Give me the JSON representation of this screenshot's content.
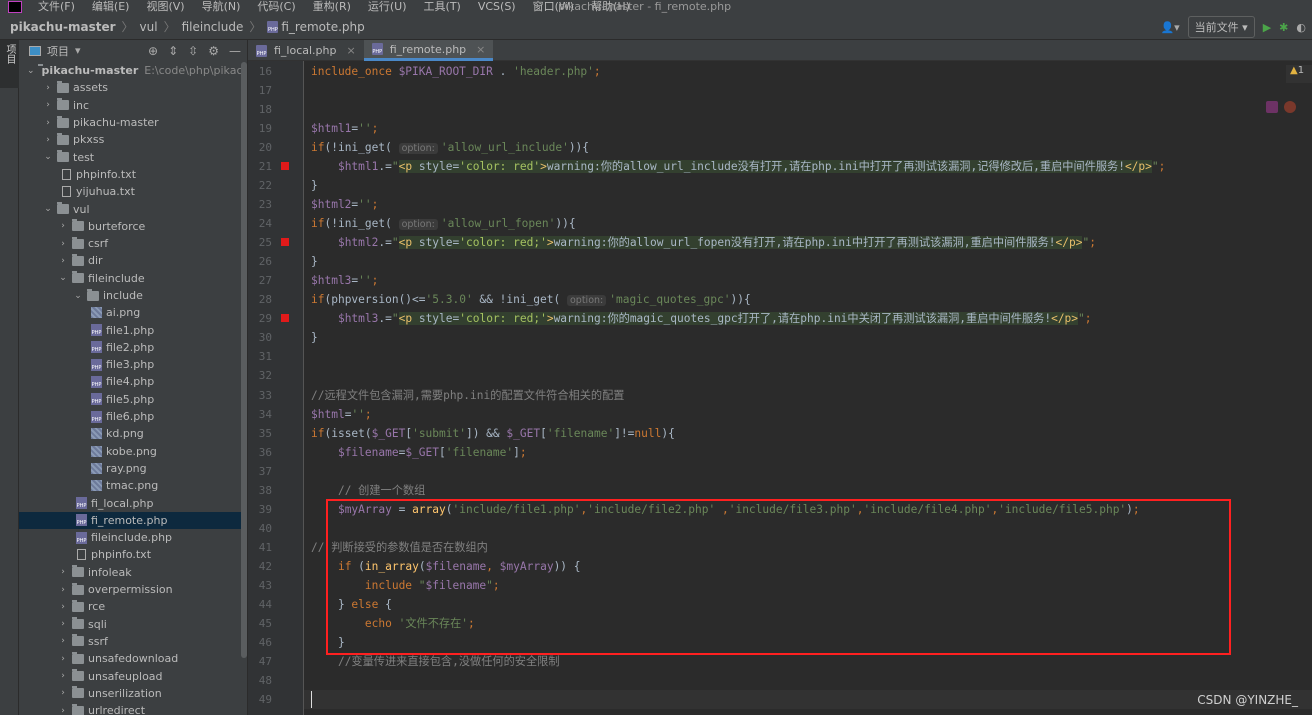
{
  "menubar": {
    "items": [
      "文件(F)",
      "编辑(E)",
      "视图(V)",
      "导航(N)",
      "代码(C)",
      "重构(R)",
      "运行(U)",
      "工具(T)",
      "VCS(S)",
      "窗口(W)",
      "帮助(H)"
    ],
    "title": "pikachu-master - fi_remote.php"
  },
  "breadcrumb": [
    "pikachu-master",
    "vul",
    "fileinclude",
    "fi_remote.php"
  ],
  "toolbar": {
    "run_config": "当前文件",
    "run_icon": "play-icon",
    "debug_icon": "bug-icon"
  },
  "left_strip": {
    "project_label": "项目"
  },
  "sidebar": {
    "title": "项目",
    "tree": [
      {
        "depth": 0,
        "type": "folder",
        "open": true,
        "label": "pikachu-master",
        "path": "E:\\code\\php\\pikachu",
        "bold": true
      },
      {
        "depth": 1,
        "type": "folder",
        "open": false,
        "label": "assets"
      },
      {
        "depth": 1,
        "type": "folder",
        "open": false,
        "label": "inc"
      },
      {
        "depth": 1,
        "type": "folder",
        "open": false,
        "label": "pikachu-master"
      },
      {
        "depth": 1,
        "type": "folder",
        "open": false,
        "label": "pkxss"
      },
      {
        "depth": 1,
        "type": "folder",
        "open": true,
        "label": "test"
      },
      {
        "depth": 2,
        "type": "txt",
        "label": "phpinfo.txt"
      },
      {
        "depth": 2,
        "type": "txt",
        "label": "yijuhua.txt"
      },
      {
        "depth": 1,
        "type": "folder",
        "open": true,
        "label": "vul"
      },
      {
        "depth": 2,
        "type": "folder",
        "open": false,
        "label": "burteforce"
      },
      {
        "depth": 2,
        "type": "folder",
        "open": false,
        "label": "csrf"
      },
      {
        "depth": 2,
        "type": "folder",
        "open": false,
        "label": "dir"
      },
      {
        "depth": 2,
        "type": "folder",
        "open": true,
        "label": "fileinclude"
      },
      {
        "depth": 3,
        "type": "folder",
        "open": true,
        "label": "include"
      },
      {
        "depth": 4,
        "type": "img",
        "label": "ai.png"
      },
      {
        "depth": 4,
        "type": "php",
        "label": "file1.php"
      },
      {
        "depth": 4,
        "type": "php",
        "label": "file2.php"
      },
      {
        "depth": 4,
        "type": "php",
        "label": "file3.php"
      },
      {
        "depth": 4,
        "type": "php",
        "label": "file4.php"
      },
      {
        "depth": 4,
        "type": "php",
        "label": "file5.php"
      },
      {
        "depth": 4,
        "type": "php",
        "label": "file6.php"
      },
      {
        "depth": 4,
        "type": "img",
        "label": "kd.png"
      },
      {
        "depth": 4,
        "type": "img",
        "label": "kobe.png"
      },
      {
        "depth": 4,
        "type": "img",
        "label": "ray.png"
      },
      {
        "depth": 4,
        "type": "img",
        "label": "tmac.png"
      },
      {
        "depth": 3,
        "type": "php",
        "label": "fi_local.php"
      },
      {
        "depth": 3,
        "type": "php",
        "label": "fi_remote.php",
        "selected": true
      },
      {
        "depth": 3,
        "type": "php",
        "label": "fileinclude.php"
      },
      {
        "depth": 3,
        "type": "txt",
        "label": "phpinfo.txt"
      },
      {
        "depth": 2,
        "type": "folder",
        "open": false,
        "label": "infoleak"
      },
      {
        "depth": 2,
        "type": "folder",
        "open": false,
        "label": "overpermission"
      },
      {
        "depth": 2,
        "type": "folder",
        "open": false,
        "label": "rce"
      },
      {
        "depth": 2,
        "type": "folder",
        "open": false,
        "label": "sqli"
      },
      {
        "depth": 2,
        "type": "folder",
        "open": false,
        "label": "ssrf"
      },
      {
        "depth": 2,
        "type": "folder",
        "open": false,
        "label": "unsafedownload"
      },
      {
        "depth": 2,
        "type": "folder",
        "open": false,
        "label": "unsafeupload"
      },
      {
        "depth": 2,
        "type": "folder",
        "open": false,
        "label": "unserilization"
      },
      {
        "depth": 2,
        "type": "folder",
        "open": false,
        "label": "urlredirect"
      }
    ]
  },
  "tabs": [
    {
      "label": "fi_local.php",
      "active": false
    },
    {
      "label": "fi_remote.php",
      "active": true
    }
  ],
  "editor": {
    "warning_count": "1",
    "current_line": 49,
    "breakpoints": [
      21,
      25,
      29
    ],
    "lines": [
      {
        "n": 16,
        "t": [
          [
            "kw",
            "include_once "
          ],
          [
            "var",
            "$PIKA_ROOT_DIR"
          ],
          [
            "p",
            " . "
          ],
          [
            "str",
            "'header.php'"
          ],
          [
            "kw",
            ";"
          ]
        ]
      },
      {
        "n": 17,
        "t": []
      },
      {
        "n": 18,
        "t": []
      },
      {
        "n": 19,
        "t": [
          [
            "var",
            "$html1"
          ],
          [
            "p",
            "="
          ],
          [
            "str",
            "''"
          ],
          [
            "kw",
            ";"
          ]
        ]
      },
      {
        "n": 20,
        "t": [
          [
            "kw",
            "if"
          ],
          [
            "p",
            "(!ini_get( "
          ],
          [
            "hint",
            "option:"
          ],
          [
            "str",
            "'allow_url_include'"
          ],
          [
            "p",
            ")){"
          ]
        ]
      },
      {
        "n": 21,
        "t": [
          [
            "p",
            "    "
          ],
          [
            "var",
            "$html1"
          ],
          [
            "p",
            ".="
          ],
          [
            "str",
            "\""
          ],
          [
            "inj-tag",
            "<p "
          ],
          [
            "inj-p",
            "style="
          ],
          [
            "inj-str",
            "'color: red'"
          ],
          [
            "inj-tag",
            ">"
          ],
          [
            "inj-p",
            "warning:你的allow_url_include没有打开,请在php.ini中打开了再测试该漏洞,记得修改后,重启中间件服务!"
          ],
          [
            "inj-tag",
            "</p>"
          ],
          [
            "str",
            "\""
          ],
          [
            "kw",
            ";"
          ]
        ]
      },
      {
        "n": 22,
        "t": [
          [
            "p",
            "}"
          ]
        ]
      },
      {
        "n": 23,
        "t": [
          [
            "var",
            "$html2"
          ],
          [
            "p",
            "="
          ],
          [
            "str",
            "''"
          ],
          [
            "kw",
            ";"
          ]
        ]
      },
      {
        "n": 24,
        "t": [
          [
            "kw",
            "if"
          ],
          [
            "p",
            "(!ini_get( "
          ],
          [
            "hint",
            "option:"
          ],
          [
            "str",
            "'allow_url_fopen'"
          ],
          [
            "p",
            ")){"
          ]
        ]
      },
      {
        "n": 25,
        "t": [
          [
            "p",
            "    "
          ],
          [
            "var",
            "$html2"
          ],
          [
            "p",
            ".="
          ],
          [
            "str",
            "\""
          ],
          [
            "inj-tag",
            "<p "
          ],
          [
            "inj-p",
            "style="
          ],
          [
            "inj-str",
            "'color: red;'"
          ],
          [
            "inj-tag",
            ">"
          ],
          [
            "inj-p",
            "warning:你的allow_url_fopen没有打开,请在php.ini中打开了再测试该漏洞,重启中间件服务!"
          ],
          [
            "inj-tag",
            "</p>"
          ],
          [
            "str",
            "\""
          ],
          [
            "kw",
            ";"
          ]
        ]
      },
      {
        "n": 26,
        "t": [
          [
            "p",
            "}"
          ]
        ]
      },
      {
        "n": 27,
        "t": [
          [
            "var",
            "$html3"
          ],
          [
            "p",
            "="
          ],
          [
            "str",
            "''"
          ],
          [
            "kw",
            ";"
          ]
        ]
      },
      {
        "n": 28,
        "t": [
          [
            "kw",
            "if"
          ],
          [
            "p",
            "(phpversion()<="
          ],
          [
            "str",
            "'5.3.0'"
          ],
          [
            "p",
            " && !ini_get( "
          ],
          [
            "hint",
            "option:"
          ],
          [
            "str",
            "'magic_quotes_gpc'"
          ],
          [
            "p",
            ")){"
          ]
        ]
      },
      {
        "n": 29,
        "t": [
          [
            "p",
            "    "
          ],
          [
            "var",
            "$html3"
          ],
          [
            "p",
            ".="
          ],
          [
            "str",
            "\""
          ],
          [
            "inj-tag",
            "<p "
          ],
          [
            "inj-p",
            "style="
          ],
          [
            "inj-str",
            "'color: red;'"
          ],
          [
            "inj-tag",
            ">"
          ],
          [
            "inj-p",
            "warning:你的magic_quotes_gpc打开了,请在php.ini中关闭了再测试该漏洞,重启中间件服务!"
          ],
          [
            "inj-tag",
            "</p>"
          ],
          [
            "str",
            "\""
          ],
          [
            "kw",
            ";"
          ]
        ]
      },
      {
        "n": 30,
        "t": [
          [
            "p",
            "}"
          ]
        ]
      },
      {
        "n": 31,
        "t": []
      },
      {
        "n": 32,
        "t": []
      },
      {
        "n": 33,
        "t": [
          [
            "cm",
            "//远程文件包含漏洞,需要php.ini的配置文件符合相关的配置"
          ]
        ]
      },
      {
        "n": 34,
        "t": [
          [
            "var",
            "$html"
          ],
          [
            "p",
            "="
          ],
          [
            "str",
            "''"
          ],
          [
            "kw",
            ";"
          ]
        ]
      },
      {
        "n": 35,
        "t": [
          [
            "kw",
            "if"
          ],
          [
            "p",
            "(isset("
          ],
          [
            "var",
            "$_GET"
          ],
          [
            "p",
            "["
          ],
          [
            "str",
            "'submit'"
          ],
          [
            "p",
            "]) && "
          ],
          [
            "var",
            "$_GET"
          ],
          [
            "p",
            "["
          ],
          [
            "str",
            "'filename'"
          ],
          [
            "p",
            "]!="
          ],
          [
            "kw",
            "null"
          ],
          [
            "p",
            "){"
          ]
        ]
      },
      {
        "n": 36,
        "t": [
          [
            "p",
            "    "
          ],
          [
            "var",
            "$filename"
          ],
          [
            "p",
            "="
          ],
          [
            "var",
            "$_GET"
          ],
          [
            "p",
            "["
          ],
          [
            "str",
            "'filename'"
          ],
          [
            "p",
            "]"
          ],
          [
            "kw",
            ";"
          ]
        ]
      },
      {
        "n": 37,
        "t": []
      },
      {
        "n": 38,
        "t": [
          [
            "p",
            "    "
          ],
          [
            "cm",
            "// 创建一个数组"
          ]
        ]
      },
      {
        "n": 39,
        "t": [
          [
            "p",
            "    "
          ],
          [
            "var",
            "$myArray"
          ],
          [
            "p",
            " = "
          ],
          [
            "fn",
            "array"
          ],
          [
            "p",
            "("
          ],
          [
            "str",
            "'include/file1.php'"
          ],
          [
            "kw",
            ","
          ],
          [
            "str",
            "'include/file2.php'"
          ],
          [
            "p",
            " "
          ],
          [
            "kw",
            ","
          ],
          [
            "str",
            "'include/file3.php'"
          ],
          [
            "kw",
            ","
          ],
          [
            "str",
            "'include/file4.php'"
          ],
          [
            "kw",
            ","
          ],
          [
            "str",
            "'include/file5.php'"
          ],
          [
            "p",
            ")"
          ],
          [
            "kw",
            ";"
          ]
        ]
      },
      {
        "n": 40,
        "t": []
      },
      {
        "n": 41,
        "t": [
          [
            "cm",
            "// 判断接受的参数值是否在数组内"
          ]
        ]
      },
      {
        "n": 42,
        "t": [
          [
            "p",
            "    "
          ],
          [
            "kw",
            "if "
          ],
          [
            "p",
            "("
          ],
          [
            "fn",
            "in_array"
          ],
          [
            "p",
            "("
          ],
          [
            "var",
            "$filename"
          ],
          [
            "kw",
            ", "
          ],
          [
            "var",
            "$myArray"
          ],
          [
            "p",
            ")) {"
          ]
        ]
      },
      {
        "n": 43,
        "t": [
          [
            "p",
            "        "
          ],
          [
            "kw",
            "include "
          ],
          [
            "str",
            "\""
          ],
          [
            "var",
            "$filename"
          ],
          [
            "str",
            "\""
          ],
          [
            "kw",
            ";"
          ]
        ]
      },
      {
        "n": 44,
        "t": [
          [
            "p",
            "    } "
          ],
          [
            "kw",
            "else "
          ],
          [
            "p",
            "{"
          ]
        ]
      },
      {
        "n": 45,
        "t": [
          [
            "p",
            "        "
          ],
          [
            "kw",
            "echo "
          ],
          [
            "str",
            "'文件不存在'"
          ],
          [
            "kw",
            ";"
          ]
        ]
      },
      {
        "n": 46,
        "t": [
          [
            "p",
            "    }"
          ]
        ]
      },
      {
        "n": 47,
        "t": [
          [
            "p",
            "    "
          ],
          [
            "cm",
            "//变量传进来直接包含,没做任何的安全限制"
          ]
        ]
      },
      {
        "n": 48,
        "t": []
      },
      {
        "n": 49,
        "t": []
      }
    ]
  },
  "watermark": "CSDN @YINZHE_"
}
